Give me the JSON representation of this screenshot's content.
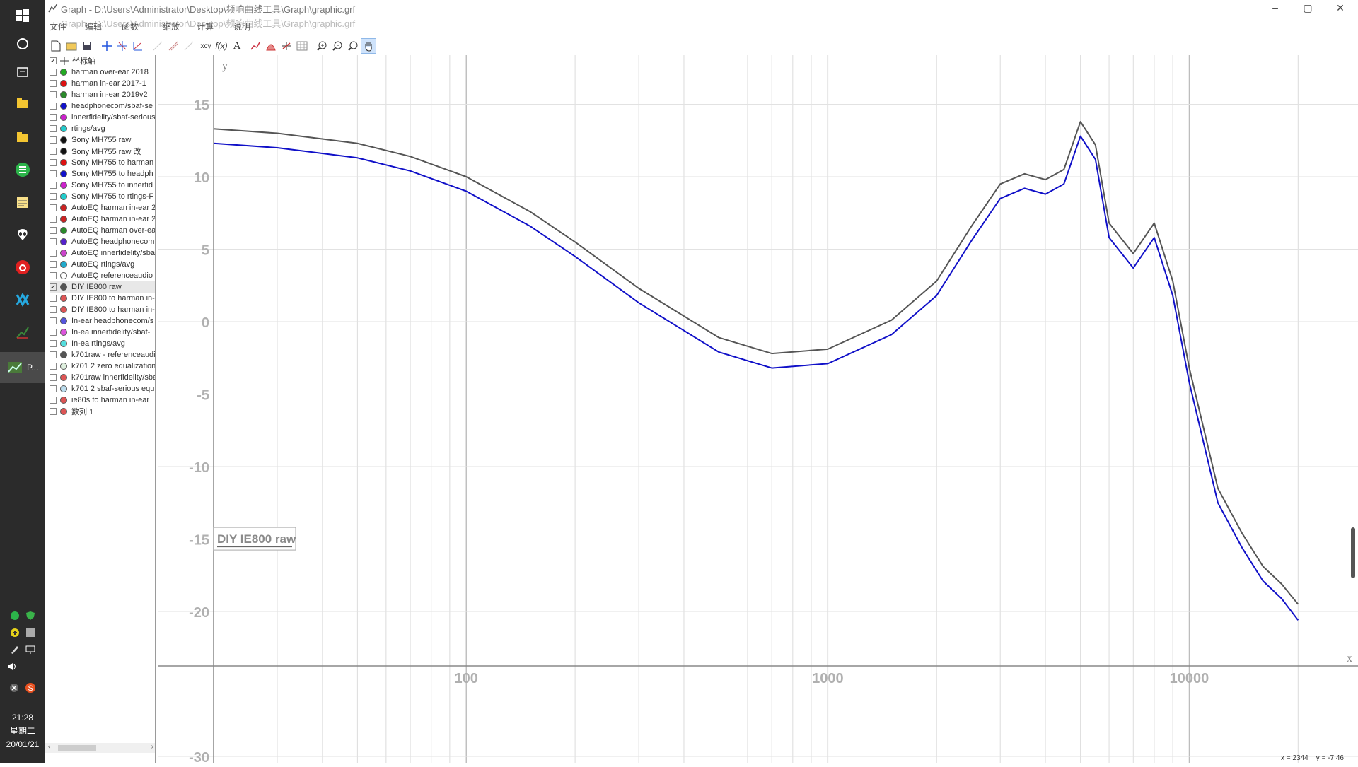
{
  "window": {
    "title": "Graph - D:\\Users\\Administrator\\Desktop\\频响曲线工具\\Graph\\graphic.grf",
    "minimize": "–",
    "maximize": "▢",
    "close": "✕"
  },
  "menu": [
    "文件",
    "编辑",
    "函数",
    "缩放",
    "计算",
    "说明"
  ],
  "sidebar": {
    "axes_label": "坐标轴",
    "items": [
      {
        "label": "harman over-ear 2018",
        "color": "#22aa22",
        "checked": false
      },
      {
        "label": "harman in-ear 2017-1",
        "color": "#dd1111",
        "checked": false
      },
      {
        "label": "harman in-ear 2019v2",
        "color": "#2a8a2a",
        "checked": false
      },
      {
        "label": "headphonecom/sbaf-se",
        "color": "#1111cc",
        "checked": false
      },
      {
        "label": "innerfidelity/sbaf-serious",
        "color": "#cc22cc",
        "checked": false
      },
      {
        "label": "rtings/avg",
        "color": "#22cccc",
        "checked": false
      },
      {
        "label": "Sony MH755 raw",
        "color": "#111111",
        "checked": false
      },
      {
        "label": "Sony MH755 raw 改",
        "color": "#111111",
        "checked": false
      },
      {
        "label": "Sony MH755 to harman",
        "color": "#dd1111",
        "checked": false
      },
      {
        "label": "Sony MH755 to headph",
        "color": "#1111cc",
        "checked": false
      },
      {
        "label": "Sony MH755 to innerfid",
        "color": "#cc22cc",
        "checked": false
      },
      {
        "label": "Sony MH755 to rtings-F",
        "color": "#22cccc",
        "checked": false
      },
      {
        "label": "AutoEQ harman in-ear 2",
        "color": "#cc2222",
        "checked": false
      },
      {
        "label": "AutoEQ harman in-ear 2",
        "color": "#cc2222",
        "checked": false
      },
      {
        "label": "AutoEQ harman over-ea",
        "color": "#2a8a2a",
        "checked": false
      },
      {
        "label": "AutoEQ headphonecom",
        "color": "#5522cc",
        "checked": false
      },
      {
        "label": "AutoEQ innerfidelity/sba",
        "color": "#cc44cc",
        "checked": false
      },
      {
        "label": "AutoEQ rtings/avg",
        "color": "#22aacc",
        "checked": false
      },
      {
        "label": "AutoEQ referenceaudio",
        "color": "#ffffff",
        "checked": false
      },
      {
        "label": "DIY IE800 raw",
        "color": "#555555",
        "checked": true
      },
      {
        "label": "DIY IE800 to harman in-",
        "color": "#dd5555",
        "checked": false
      },
      {
        "label": "DIY IE800 to harman in-",
        "color": "#dd5555",
        "checked": false
      },
      {
        "label": "In-ear headphonecom/s",
        "color": "#5555dd",
        "checked": false
      },
      {
        "label": "In-ea innerfidelity/sbaf-",
        "color": "#dd55dd",
        "checked": false
      },
      {
        "label": "In-ea rtings/avg",
        "color": "#55dddd",
        "checked": false
      },
      {
        "label": "k701raw - referenceaudi",
        "color": "#555555",
        "checked": false
      },
      {
        "label": "k701 2 zero equalization",
        "color": "#ddeedd",
        "checked": false
      },
      {
        "label": "k701raw innerfidelity/sba",
        "color": "#dd5555",
        "checked": false
      },
      {
        "label": "k701 2 sbaf-serious equ",
        "color": "#bbddee",
        "checked": false
      },
      {
        "label": "ie80s  to harman in-ear",
        "color": "#dd5555",
        "checked": false
      },
      {
        "label": "数列 1",
        "color": "#dd5555",
        "checked": false
      }
    ]
  },
  "graph": {
    "y_axis_label": "y",
    "x_axis_label": "x",
    "x_scale": "log",
    "x_ticks": [
      "100",
      "1000",
      "10000"
    ],
    "y_ticks": [
      "15",
      "10",
      "5",
      "0",
      "-5",
      "-10",
      "-15",
      "-20",
      "-30"
    ],
    "legend_text": "DIY IE800 raw",
    "status_x": "x = 2344",
    "status_y": "y = -7.46"
  },
  "chart_data": {
    "type": "line",
    "x_scale": "log",
    "xlim": [
      20,
      28000
    ],
    "ylim": [
      -30,
      18
    ],
    "series": [
      {
        "name": "DIY IE800 raw",
        "color": "#555555",
        "x": [
          20,
          30,
          50,
          70,
          100,
          150,
          200,
          300,
          500,
          700,
          1000,
          1500,
          2000,
          2500,
          3000,
          3500,
          4000,
          4500,
          5000,
          5500,
          6000,
          7000,
          8000,
          9000,
          10000,
          12000,
          14000,
          16000,
          18000,
          20000
        ],
        "y": [
          13.3,
          13,
          12.3,
          11.4,
          10,
          7.6,
          5.5,
          2.3,
          -1.1,
          -2.2,
          -1.9,
          0.1,
          2.8,
          6.6,
          9.5,
          10.2,
          9.8,
          10.5,
          13.8,
          12.2,
          6.8,
          4.7,
          6.8,
          2.8,
          -3.2,
          -11.5,
          -14.6,
          -16.9,
          -18.1,
          -19.5
        ]
      },
      {
        "name": "",
        "color": "#1010c8",
        "x": [
          20,
          30,
          50,
          70,
          100,
          150,
          200,
          300,
          500,
          700,
          1000,
          1500,
          2000,
          2500,
          3000,
          3500,
          4000,
          4500,
          5000,
          5500,
          6000,
          7000,
          8000,
          9000,
          10000,
          12000,
          14000,
          16000,
          18000,
          20000
        ],
        "y": [
          12.3,
          12,
          11.3,
          10.4,
          9,
          6.6,
          4.5,
          1.3,
          -2.1,
          -3.2,
          -2.9,
          -0.9,
          1.8,
          5.6,
          8.5,
          9.2,
          8.8,
          9.5,
          12.8,
          11.2,
          5.8,
          3.7,
          5.8,
          1.8,
          -4.2,
          -12.5,
          -15.6,
          -17.9,
          -19.1,
          -20.6
        ]
      }
    ]
  }
}
